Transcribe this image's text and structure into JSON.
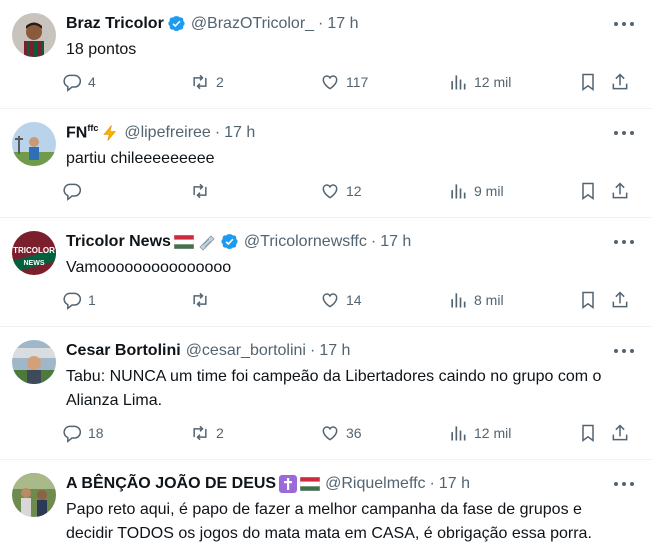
{
  "tweets": [
    {
      "name": "Braz Tricolor",
      "name_sup": "",
      "handle": "@BrazOTricolor_",
      "time": "17 h",
      "text": "18 pontos",
      "replies": "4",
      "retweets": "2",
      "likes": "117",
      "views": "12 mil",
      "verified": true,
      "emoji": [],
      "avatar_icon": "profile-photo-player"
    },
    {
      "name": "FN",
      "name_sup": "ffc",
      "handle": "@lipefreiree",
      "time": "17 h",
      "text": "partiu chileeeeeeeee",
      "replies": "",
      "retweets": "",
      "likes": "12",
      "views": "9 mil",
      "verified": false,
      "emoji": [
        "lightning-emoji"
      ],
      "avatar_icon": "profile-photo-outdoor"
    },
    {
      "name": "Tricolor News",
      "name_sup": "",
      "handle": "@Tricolornewsffc",
      "time": "17 h",
      "text": "Vamooooooooooooooo",
      "replies": "1",
      "retweets": "",
      "likes": "14",
      "views": "8 mil",
      "verified": true,
      "emoji": [
        "hungary-flag-emoji",
        "newspaper-emoji"
      ],
      "avatar_icon": "tricolor-news-logo",
      "avatar_text": [
        "TRICOLOR",
        "NEWS"
      ]
    },
    {
      "name": "Cesar Bortolini",
      "name_sup": "",
      "handle": "@cesar_bortolini",
      "time": "17 h",
      "text": "Tabu: NUNCA um time foi campeão da Libertadores caindo no grupo com o\nAlianza Lima.",
      "replies": "18",
      "retweets": "2",
      "likes": "36",
      "views": "12 mil",
      "verified": false,
      "emoji": [],
      "avatar_icon": "profile-photo-stadium"
    },
    {
      "name": "A BÊNÇÃO JOÃO DE DEUS",
      "name_sup": "",
      "handle": "@Riquelmeffc",
      "time": "17 h",
      "text": "Papo reto aqui, é papo de fazer a melhor campanha da fase de grupos e\ndecidir TODOS os jogos do mata mata em CASA, é obrigação essa porra.",
      "replies": "",
      "retweets": "",
      "likes": "",
      "views": "",
      "verified": false,
      "emoji": [
        "cross-emoji",
        "hungary-flag-emoji"
      ],
      "avatar_icon": "profile-photo-group"
    }
  ],
  "colors": {
    "text": "#0f1419",
    "secondary": "#536471",
    "verified": "#1d9bf0",
    "divider": "#eff3f4",
    "fluminense_red": "#7a1f2b",
    "fluminense_green": "#00613c"
  }
}
